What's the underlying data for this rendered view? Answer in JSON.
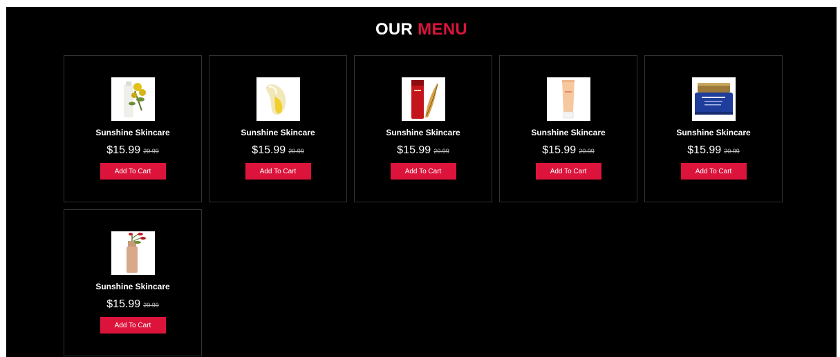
{
  "section": {
    "title_word1": "OUR",
    "title_word2": "MENU",
    "accent_color": "#dc143c"
  },
  "products": [
    {
      "name": "Sunshine Skincare",
      "price": "$15.99",
      "old_price": "20.99",
      "button": "Add To Cart",
      "image": "cleanser-bottle-with-flowers"
    },
    {
      "name": "Sunshine Skincare",
      "price": "$15.99",
      "old_price": "20.99",
      "button": "Add To Cart",
      "image": "cream-swatch"
    },
    {
      "name": "Sunshine Skincare",
      "price": "$15.99",
      "old_price": "20.99",
      "button": "Add To Cart",
      "image": "red-serum-tube"
    },
    {
      "name": "Sunshine Skincare",
      "price": "$15.99",
      "old_price": "20.99",
      "button": "Add To Cart",
      "image": "peach-cream-tube"
    },
    {
      "name": "Sunshine Skincare",
      "price": "$15.99",
      "old_price": "20.99",
      "button": "Add To Cart",
      "image": "blue-cream-jar"
    },
    {
      "name": "Sunshine Skincare",
      "price": "$15.99",
      "old_price": "20.99",
      "button": "Add To Cart",
      "image": "foundation-bottle-with-flower"
    }
  ]
}
